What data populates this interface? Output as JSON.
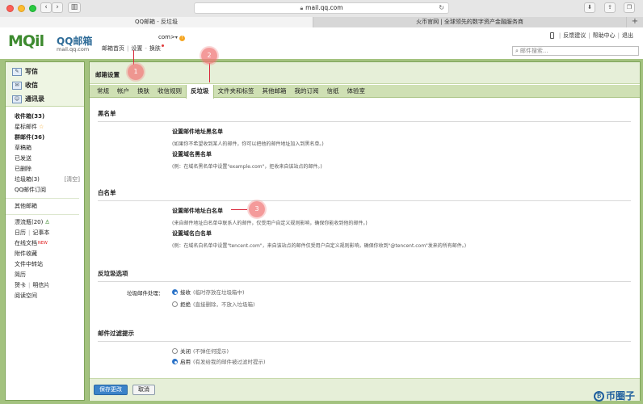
{
  "browser": {
    "url": "mail.qq.com",
    "tabs": [
      {
        "label": "QQ邮箱 - 反垃圾",
        "active": true
      },
      {
        "label": "火币官网 | 全球领先的数字资产金融服务商",
        "active": false
      }
    ],
    "new_tab": "+"
  },
  "header": {
    "logo_text": "MQil",
    "logo_cn": "QQ邮箱",
    "logo_domain": "mail.qq.com",
    "account_suffix": "com>",
    "account_badge": "!",
    "links": {
      "home": "邮箱首页",
      "settings": "设置",
      "skin": "换肤"
    },
    "right_links": {
      "feedback": "反馈建议",
      "help": "帮助中心",
      "logout": "退出"
    },
    "search_placeholder": "邮件搜索..."
  },
  "sidebar": {
    "buttons": [
      {
        "label": "写信",
        "icon": "pencil-icon"
      },
      {
        "label": "收信",
        "icon": "inbox-icon"
      },
      {
        "label": "通讯录",
        "icon": "contacts-icon"
      }
    ],
    "folders": {
      "inbox": "收件箱(33)",
      "starred": "星标邮件",
      "groups": "群邮件(36)",
      "drafts": "草稿箱",
      "sent": "已发送",
      "deleted": "已删除",
      "spam": "垃圾箱(3)",
      "spam_clear": "[清空]",
      "subscriptions": "QQ邮件订阅",
      "other": "其他邮箱",
      "drift": "漂流瓶(20)",
      "calendar": "日历",
      "notes": "记事本",
      "online_docs": "在线文档",
      "online_docs_badge": "NEW",
      "attachments": "附件收藏",
      "transfer": "文件中转站",
      "resume": "简历",
      "cards": "贺卡",
      "postcards": "明信片",
      "reading": "阅读空间"
    }
  },
  "main": {
    "title": "邮箱设置",
    "tabs": [
      {
        "label": "常规",
        "active": false
      },
      {
        "label": "帐户",
        "active": false
      },
      {
        "label": "换肤",
        "active": false
      },
      {
        "label": "收信规则",
        "active": false
      },
      {
        "label": "反垃圾",
        "active": true
      },
      {
        "label": "文件夹和标签",
        "active": false
      },
      {
        "label": "其他邮箱",
        "active": false
      },
      {
        "label": "我的订阅",
        "active": false
      },
      {
        "label": "信纸",
        "active": false
      },
      {
        "label": "体验室",
        "active": false
      }
    ],
    "blacklist": {
      "title": "黑名单",
      "addr_title": "设置邮件地址黑名单",
      "addr_note": "(如果你不希望收到某人的邮件，你可以把他的邮件地址加入到黑名单。)",
      "domain_title": "设置域名黑名单",
      "domain_note": "(例：在域名黑名单中设置\"example.com\"，拒收来自该站点的邮件。)"
    },
    "whitelist": {
      "title": "白名单",
      "addr_title": "设置邮件地址白名单",
      "addr_note": "(来自邮件地址白名单中联系人的邮件，仅受用户自定义规则影响，确保你能收到他的邮件。)",
      "domain_title": "设置域名白名单",
      "domain_note": "(例：在域名白名单中设置\"tencent.com\"，来自该站点的邮件仅受用户自定义规则影响，确保你收到\"@tencent.com\"发来的所有邮件。)"
    },
    "antispam": {
      "title": "反垃圾选项",
      "label": "垃圾邮件处理：",
      "options": [
        {
          "label": "接收",
          "hint": "(临时存放在垃圾箱中)",
          "checked": true
        },
        {
          "label": "拒绝",
          "hint": "(直接删除，不放入垃圾箱)",
          "checked": false
        }
      ]
    },
    "filter_hint": {
      "title": "邮件过滤提示",
      "options": [
        {
          "label": "关闭",
          "hint": "(不弹任何提示)",
          "checked": false
        },
        {
          "label": "启用",
          "hint": "(有发给我的邮件被过滤时提示)",
          "checked": true
        }
      ]
    },
    "buttons": {
      "save": "保存更改",
      "cancel": "取消"
    }
  },
  "annotations": [
    "1",
    "2",
    "3"
  ],
  "watermark": "币圈子",
  "colors": {
    "frame_green": "#a3c27f",
    "tab_bar": "#cfe0b4",
    "primary_blue": "#3b83c9",
    "annotation": "#f07878"
  }
}
